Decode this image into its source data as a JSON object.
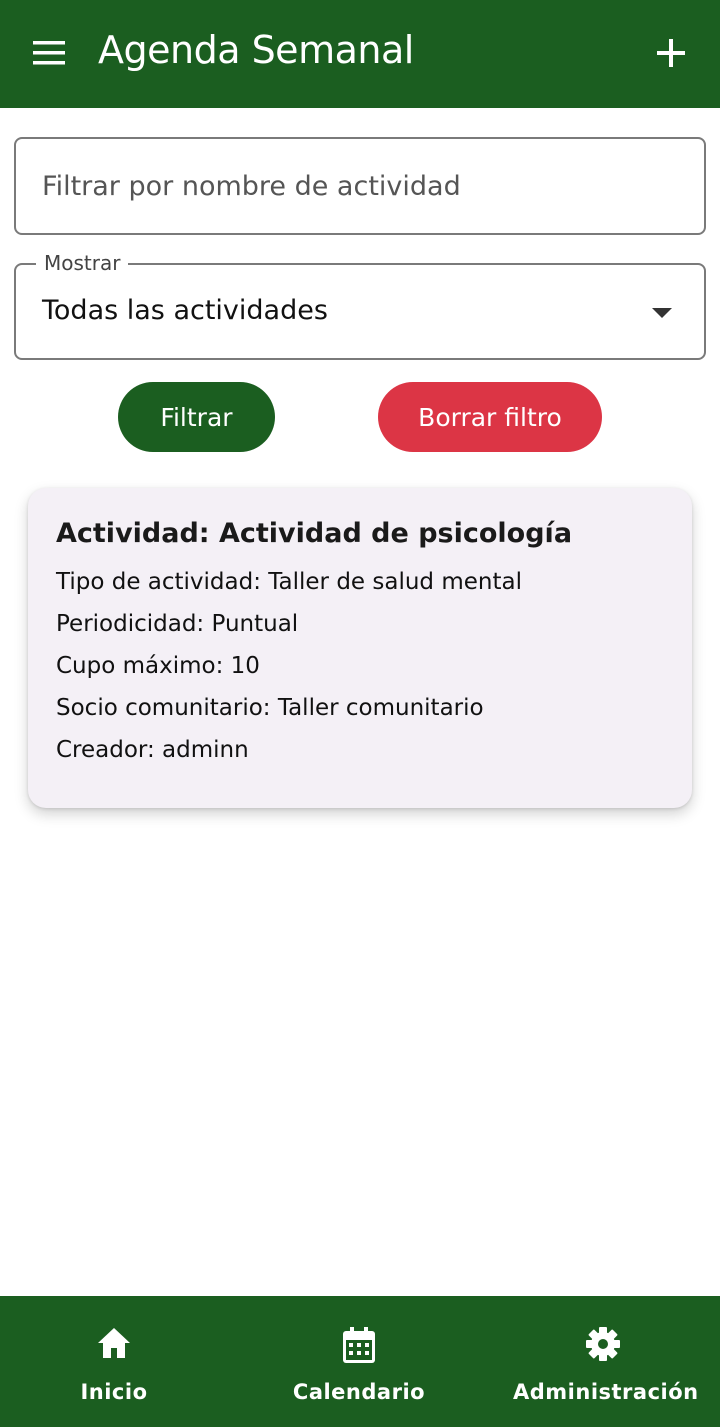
{
  "appbar": {
    "title": "Agenda Semanal",
    "menu_icon": "hamburger-menu-icon",
    "add_icon": "plus-icon",
    "color": "#1b5e20"
  },
  "filter": {
    "placeholder": "Filtrar por nombre de actividad",
    "value": ""
  },
  "show_select": {
    "label": "Mostrar",
    "selected": "Todas las actividades"
  },
  "buttons": {
    "filter_label": "Filtrar",
    "clear_label": "Borrar filtro",
    "filter_color": "#1b5e20",
    "clear_color": "#dc3545"
  },
  "activities": [
    {
      "title": "Actividad: Actividad de psicología",
      "type": "Tipo de actividad: Taller de salud mental",
      "periodicity": "Periodicidad: Puntual",
      "capacity": "Cupo máximo: 10",
      "partner": "Socio comunitario: Taller comunitario",
      "creator": "Creador: adminn"
    }
  ],
  "bottom_nav": {
    "items": [
      {
        "label": "Inicio",
        "icon": "home-icon"
      },
      {
        "label": "Calendario",
        "icon": "calendar-icon"
      },
      {
        "label": "Administración",
        "icon": "gear-icon"
      }
    ]
  }
}
